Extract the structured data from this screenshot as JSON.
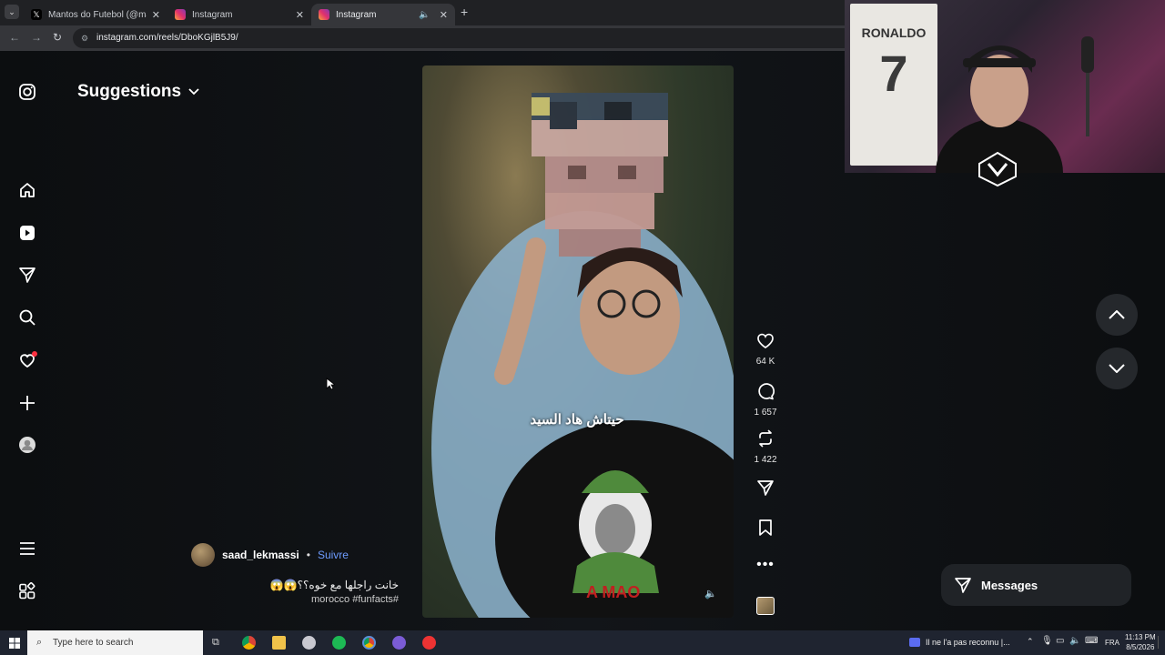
{
  "browser": {
    "tabs": [
      {
        "title": "Mantos do Futebol (@mantosd",
        "icon": "x-logo-icon",
        "active": false
      },
      {
        "title": "Instagram",
        "icon": "instagram-icon",
        "active": false
      },
      {
        "title": "Instagram",
        "icon": "instagram-icon",
        "active": true
      }
    ],
    "url": "instagram.com/reels/DboKGjlB5J9/"
  },
  "instagram": {
    "suggestions_title": "Suggestions",
    "reel": {
      "subtitle": "حيتاش هاد السيد",
      "likes": "64 K",
      "comments": "1 657",
      "reposts": "1 422",
      "author": "saad_lekmassi",
      "separator": "•",
      "follow_label": "Suivre",
      "caption": "خانت راجلها مع خوه؟؟😱😱",
      "hashtags": "morocco #funfacts#"
    },
    "messages_label": "Messages"
  },
  "webcam": {
    "jersey_name": "RONALDO",
    "jersey_number": "7"
  },
  "taskbar": {
    "search_placeholder": "Type here to search",
    "notification_text": "Il ne l'a pas reconnu |...",
    "language": "FRA",
    "time": "11:13 PM",
    "date": "8/5/2026"
  },
  "colors": {
    "follow_link": "#6e9cff",
    "notification_dot": "#ff3040"
  }
}
